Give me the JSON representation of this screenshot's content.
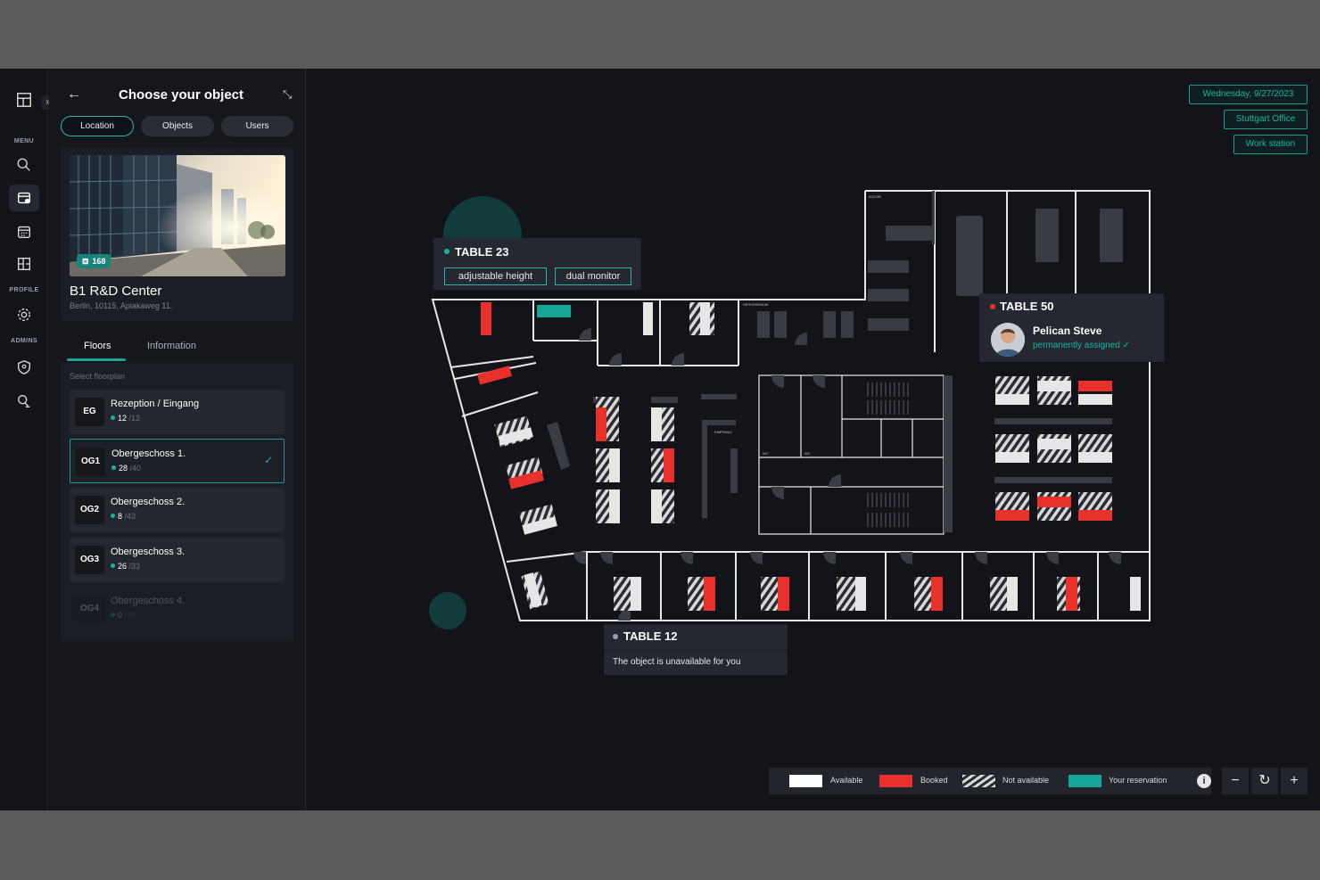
{
  "rail": {
    "sections": [
      "MENU",
      "PROFILE",
      "ADMINS"
    ],
    "expand_label": "»"
  },
  "panel": {
    "title": "Choose your object",
    "back_label": "←",
    "collapse_label": "⤡",
    "segments": [
      "Location",
      "Objects",
      "Users"
    ],
    "location": {
      "name": "B1 R&D Center",
      "address": "Berlin, 10115, Aplakaweg 11.",
      "capacity": "168"
    },
    "tabs": [
      "Floors",
      "Information"
    ],
    "select_label": "Select floorplan",
    "floors": [
      {
        "code": "EG",
        "name": "Rezeption / Eingang",
        "count": "12",
        "total": "/12"
      },
      {
        "code": "OG1",
        "name": "Obergeschoss 1.",
        "count": "28",
        "total": "/40"
      },
      {
        "code": "OG2",
        "name": "Obergeschoss 2.",
        "count": "8",
        "total": "/43"
      },
      {
        "code": "OG3",
        "name": "Obergeschoss 3.",
        "count": "26",
        "total": "/33"
      },
      {
        "code": "OG4",
        "name": "Obergeschoss 4.",
        "count": "0",
        "total": "/40"
      }
    ]
  },
  "filters": {
    "date": "Wednesday, 9/27/2023",
    "office": "Stuttgart Office",
    "type": "Work station"
  },
  "rooms": {
    "kitchen": "KÜCHE",
    "server": "SERVERRAUM",
    "reception": "EMPFANG",
    "wc": "WC"
  },
  "tooltips": {
    "table23": {
      "title": "TABLE 23",
      "tags": [
        "adjustable height",
        "dual monitor"
      ],
      "status_color": "#1bb3a3"
    },
    "table50": {
      "title": "TABLE 50",
      "user": "Pelican Steve",
      "note": "permanently assigned",
      "status_color": "#e8312b"
    },
    "table12": {
      "title": "TABLE 12",
      "message": "The object is unavailable for you",
      "status_color": "#9aa0aa"
    }
  },
  "legend": [
    {
      "label": "Available",
      "color": "#ffffff"
    },
    {
      "label": "Booked",
      "color": "#e8312b"
    },
    {
      "label": "Not available",
      "color": "hatched"
    },
    {
      "label": "Your reservation",
      "color": "#17a597"
    }
  ],
  "controls": {
    "info": "i",
    "zoom_out": "−",
    "reset": "↻",
    "zoom_in": "+"
  }
}
